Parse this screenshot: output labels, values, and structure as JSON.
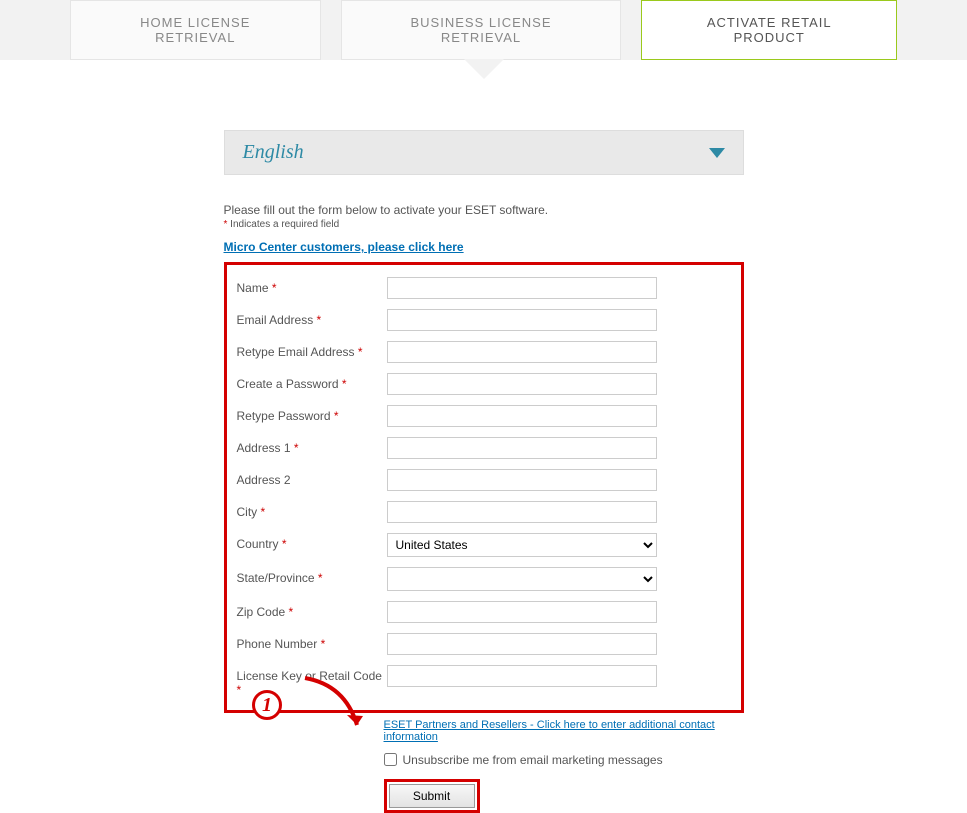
{
  "tabs": {
    "home": "HOME LICENSE RETRIEVAL",
    "business": "BUSINESS LICENSE RETRIEVAL",
    "activate": "ACTIVATE RETAIL PRODUCT"
  },
  "language": {
    "selected": "English"
  },
  "instructions": {
    "main": "Please fill out the form below to activate your ESET software.",
    "required_note_prefix": "*",
    "required_note": " Indicates a required field",
    "micro_center_link": "Micro Center customers, please click here"
  },
  "form": {
    "name": "Name",
    "email": "Email Address",
    "retype_email": "Retype Email Address",
    "create_password": "Create a Password",
    "retype_password": "Retype Password",
    "address1": "Address 1",
    "address2": "Address 2",
    "city": "City",
    "country": "Country",
    "country_value": "United States",
    "state": "State/Province",
    "state_value": "",
    "zip": "Zip Code",
    "phone": "Phone Number",
    "license_key": "License Key or Retail Code"
  },
  "below": {
    "partners_link": "ESET Partners and Resellers - Click here to enter additional contact information",
    "unsubscribe": "Unsubscribe me from email marketing messages",
    "submit": "Submit"
  },
  "annotation": {
    "step": "1"
  }
}
